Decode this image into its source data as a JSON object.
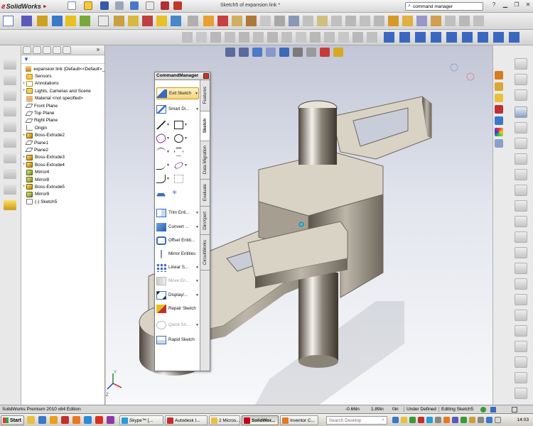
{
  "app": {
    "name": "SolidWorks",
    "window_title": "Sketch5 of expansion link *"
  },
  "search": {
    "value": "command manager"
  },
  "tree": {
    "items": [
      {
        "label": "expansion link  (Default<<Default>_",
        "expander": "",
        "icon": "part-icon",
        "cls": "doc"
      },
      {
        "label": "Sensors",
        "expander": "",
        "icon": "sensors-folder-icon",
        "cls": "folder"
      },
      {
        "label": "Annotations",
        "expander": "+",
        "icon": "annotations-icon",
        "cls": "annot"
      },
      {
        "label": "Lights, Cameras and Scene",
        "expander": "+",
        "icon": "lights-icon",
        "cls": "light"
      },
      {
        "label": "Material <not specified>",
        "expander": "",
        "icon": "material-icon",
        "cls": "mat"
      },
      {
        "label": "Front Plane",
        "expander": "",
        "icon": "plane-icon",
        "cls": "plane"
      },
      {
        "label": "Top Plane",
        "expander": "",
        "icon": "plane-icon",
        "cls": "plane"
      },
      {
        "label": "Right Plane",
        "expander": "",
        "icon": "plane-icon",
        "cls": "plane"
      },
      {
        "label": "Origin",
        "expander": "",
        "icon": "origin-icon",
        "cls": "origin"
      },
      {
        "label": "Boss-Extrude2",
        "expander": "+",
        "icon": "extrude-icon",
        "cls": "feat"
      },
      {
        "label": "Plane1",
        "expander": "",
        "icon": "plane-icon",
        "cls": "plane"
      },
      {
        "label": "Plane2",
        "expander": "",
        "icon": "plane-icon",
        "cls": "plane"
      },
      {
        "label": "Boss-Extrude3",
        "expander": "+",
        "icon": "extrude-icon",
        "cls": "feat"
      },
      {
        "label": "Boss-Extrude4",
        "expander": "+",
        "icon": "extrude-icon",
        "cls": "feat"
      },
      {
        "label": "Mirror4",
        "expander": "",
        "icon": "mirror-icon",
        "cls": "mirror"
      },
      {
        "label": "Mirror8",
        "expander": "",
        "icon": "mirror-icon",
        "cls": "mirror"
      },
      {
        "label": "Boss-Extrude5",
        "expander": "+",
        "icon": "extrude-icon",
        "cls": "feat"
      },
      {
        "label": "Mirror9",
        "expander": "",
        "icon": "mirror-icon",
        "cls": "mirror"
      },
      {
        "label": "(-) Sketch5",
        "expander": "",
        "icon": "sketch-icon",
        "cls": "sketch"
      }
    ]
  },
  "command_manager": {
    "title": "CommandManager",
    "tabs": [
      "Features",
      "Sketch",
      "Data Migration",
      "Evaluate",
      "DimXpert",
      "CircuitWorks"
    ],
    "active_tab": "Sketch",
    "commands": {
      "exit_sketch": "Exit Sketch",
      "smart_dim": "Smart Di...",
      "trim": "Trim Enti...",
      "convert": "Convert ...",
      "offset": "Offset Entiti...",
      "mirror": "Mirror Entities",
      "linear": "Linear S...",
      "move": "Move En...",
      "display": "Display/...",
      "repair": "Repair Sketch",
      "quick_snaps": "Quick Sn...",
      "rapid": "Rapid Sketch"
    }
  },
  "status": {
    "edition": "SolidWorks Premium 2010 x64 Edition",
    "x": "-0.66in",
    "y": "1.89in",
    "z": "0in",
    "state": "Under Defined",
    "editing": "Editing Sketch5"
  },
  "taskbar": {
    "start": "Start",
    "tasks": [
      "Skype™ [...",
      "Autodesk I...",
      "2 Micros...",
      "SolidWor...",
      "Inventor C..."
    ],
    "active_task": "SolidWor...",
    "desktop_search": "Search Desktop",
    "clock": "14:03"
  },
  "colors": {
    "accent": "#c0001a",
    "viewport_top": "#c2c6d6",
    "viewport_bottom": "#f7f8fa",
    "part_face": "#d9d3c6",
    "part_side": "#8c8579"
  }
}
